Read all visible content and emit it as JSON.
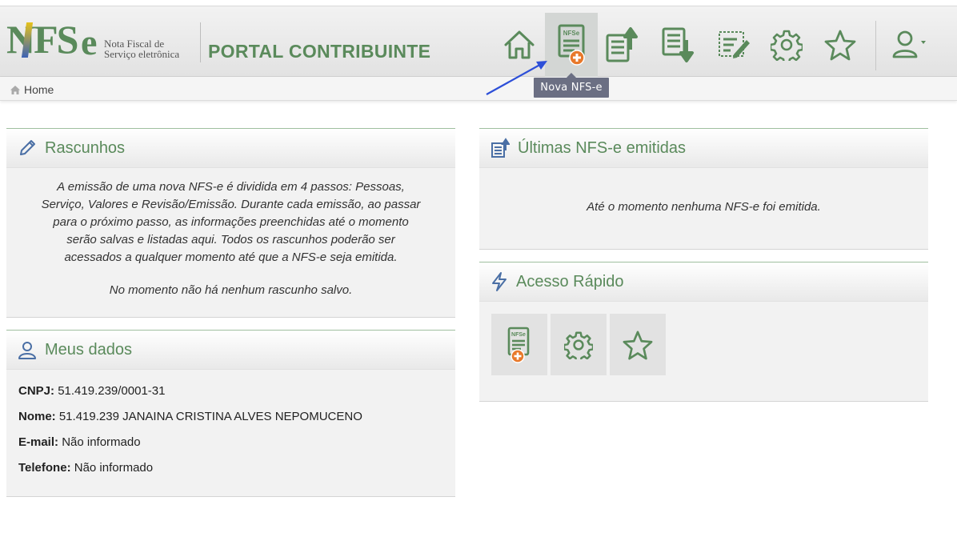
{
  "header": {
    "logo_text": "NFS",
    "logo_e": "e",
    "logo_sub_line1": "Nota Fiscal de",
    "logo_sub_line2": "Serviço eletrônica",
    "portal_title": "PORTAL CONTRIBUINTE",
    "nav": [
      {
        "name": "home",
        "icon": "home-icon"
      },
      {
        "name": "nova-nfse",
        "icon": "nfse-add-icon",
        "badge": "NFSe"
      },
      {
        "name": "emitidas",
        "icon": "doc-upload-icon"
      },
      {
        "name": "recebidas",
        "icon": "doc-download-icon"
      },
      {
        "name": "rascunhos",
        "icon": "doc-edit-icon"
      },
      {
        "name": "config",
        "icon": "gear-icon"
      },
      {
        "name": "favoritos",
        "icon": "star-icon"
      },
      {
        "name": "usuario",
        "icon": "user-icon"
      }
    ],
    "tooltip": "Nova NFS-e"
  },
  "breadcrumb": {
    "home": "Home"
  },
  "colors": {
    "brand_green": "#5a8a5b",
    "orange": "#e8792b",
    "tooltip_bg": "#6b6f83",
    "arrow_blue": "#2d4fd8"
  },
  "rascunhos": {
    "title": "Rascunhos",
    "line1": "A emissão de uma nova NFS-e é dividida em 4 passos: Pessoas,",
    "line2": "Serviço, Valores e Revisão/Emissão. Durante cada emissão, ao passar",
    "line3": "para o próximo passo, as informações preenchidas até o momento",
    "line4": "serão salvas e listadas aqui. Todos os rascunhos poderão ser",
    "line5": "acessados a qualquer momento até que a NFS-e seja emitida.",
    "empty": "No momento não há nenhum rascunho salvo."
  },
  "meus_dados": {
    "title": "Meus dados",
    "cnpj_label": "CNPJ:",
    "cnpj": "51.419.239/0001-31",
    "nome_label": "Nome:",
    "nome": "51.419.239 JANAINA CRISTINA ALVES NEPOMUCENO",
    "email_label": "E-mail:",
    "email": "Não informado",
    "telefone_label": "Telefone:",
    "telefone": "Não informado"
  },
  "ultimas": {
    "title": "Últimas NFS-e emitidas",
    "empty": "Até o momento nenhuma NFS-e foi emitida."
  },
  "acesso_rapido": {
    "title": "Acesso Rápido",
    "badge": "NFSe"
  }
}
